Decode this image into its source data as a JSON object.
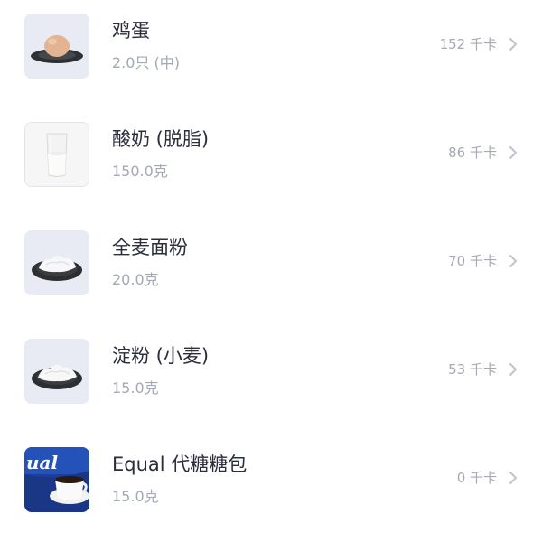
{
  "foods": [
    {
      "name": "鸡蛋",
      "amount": "2.0只 (中)",
      "calories": "152 千卡",
      "thumbnail": "egg-on-plate",
      "chevron": "chevron-right-icon"
    },
    {
      "name": "酸奶 (脱脂)",
      "amount": "150.0克",
      "calories": "86 千卡",
      "thumbnail": "glass-of-yogurt",
      "chevron": "chevron-right-icon"
    },
    {
      "name": "全麦面粉",
      "amount": "20.0克",
      "calories": "70 千卡",
      "thumbnail": "flour-in-bowl",
      "chevron": "chevron-right-icon"
    },
    {
      "name": "淀粉 (小麦)",
      "amount": "15.0克",
      "calories": "53 千卡",
      "thumbnail": "starch-in-bowl",
      "chevron": "chevron-right-icon"
    },
    {
      "name": "Equal 代糖糖包",
      "amount": "15.0克",
      "calories": "0 千卡",
      "thumbnail": "equal-sweetener-box-and-coffee",
      "logo_text": "ual",
      "chevron": "chevron-right-icon"
    }
  ]
}
